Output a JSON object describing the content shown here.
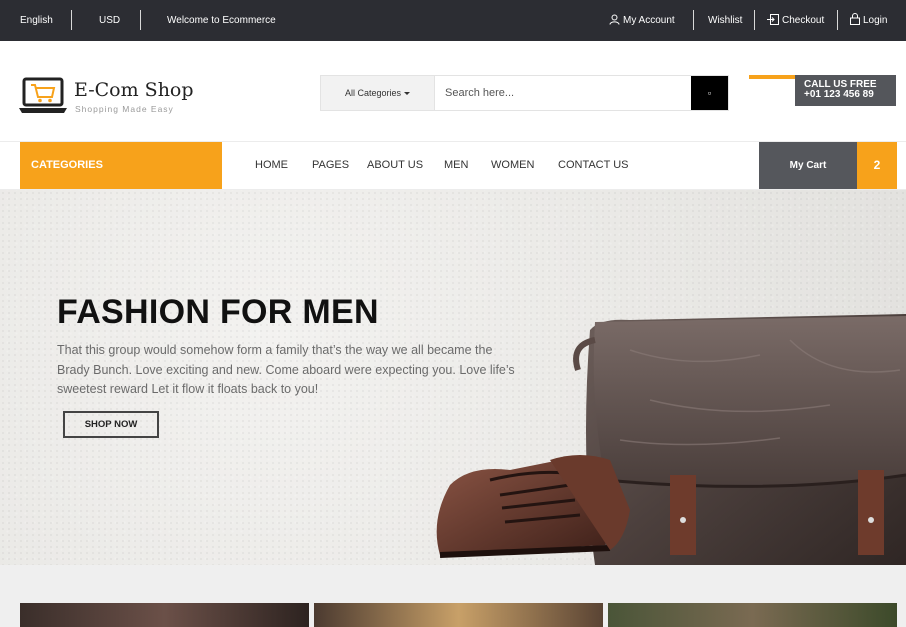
{
  "topbar": {
    "language": "English",
    "currency": "USD",
    "welcome": "Welcome to Ecommerce",
    "my_account": "My Account",
    "wishlist": "Wishlist",
    "checkout": "Checkout",
    "login": "Login"
  },
  "brand": {
    "name": "E-Com Shop",
    "tagline": "Shopping Made Easy"
  },
  "search": {
    "category_label": "All Categories",
    "placeholder": "Search here...",
    "button_glyph": "▫"
  },
  "callus": {
    "label": "CALL US FREE",
    "phone": "+01 123 456 89"
  },
  "nav": {
    "categories": "CATEGORIES",
    "items": [
      "HOME",
      "PAGES",
      "ABOUT US",
      "MEN",
      "WOMEN",
      "CONTACT US"
    ]
  },
  "cart": {
    "label": "My Cart",
    "count": "2"
  },
  "hero": {
    "title": "FASHION FOR MEN",
    "text": "That this group would somehow form a family that’s the way we all became the Brady Bunch. Love exciting and new. Come aboard were expecting you. Love life’s sweetest reward Let it flow it floats back to you!",
    "button": "SHOP NOW"
  },
  "colors": {
    "accent": "#f7a21b",
    "dark": "#2c2d33",
    "gray": "#55575c"
  },
  "icons": {
    "account": "user-icon",
    "checkout": "sign-in-icon",
    "login": "lock-icon",
    "logo": "laptop-cart-icon",
    "search": "search-icon"
  }
}
